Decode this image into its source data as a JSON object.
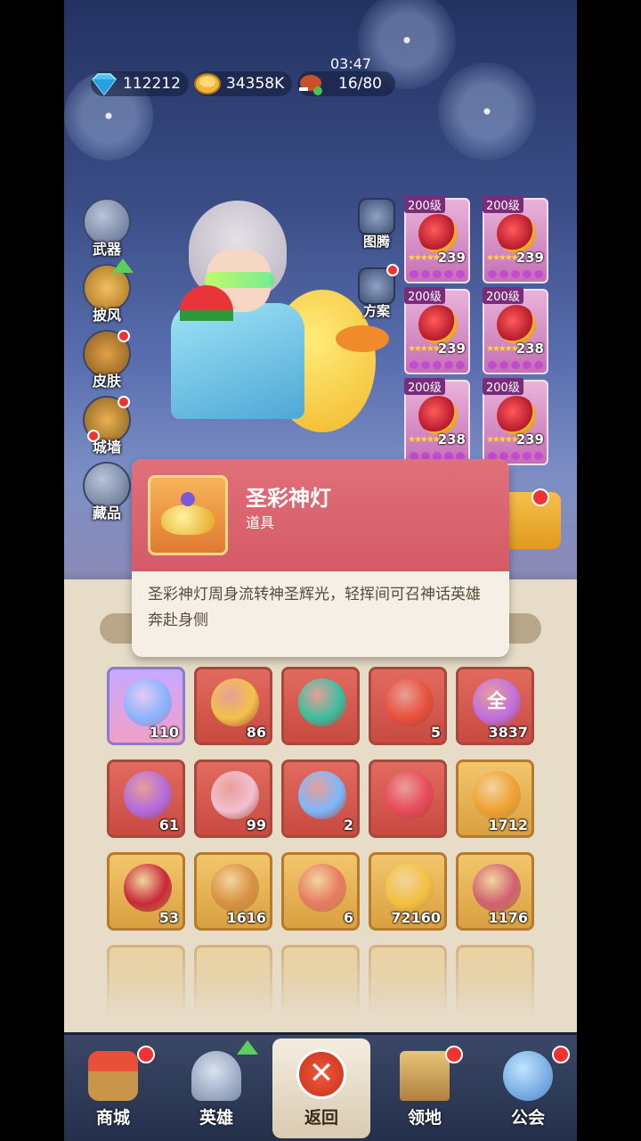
{
  "top_bar": {
    "diamonds": "112212",
    "gold": "34358K",
    "timer": "03:47",
    "stamina": "16/80"
  },
  "left_menu": [
    {
      "label": "武器",
      "icon": "weapon-icon"
    },
    {
      "label": "披风",
      "icon": "cape-icon"
    },
    {
      "label": "皮肤",
      "icon": "skin-icon"
    },
    {
      "label": "城墙",
      "icon": "wall-icon"
    },
    {
      "label": "藏品",
      "icon": "collection-icon"
    }
  ],
  "right_menu": [
    {
      "label": "图腾",
      "icon": "totem-icon"
    },
    {
      "label": "方案",
      "icon": "scheme-icon"
    }
  ],
  "equipment_slots": [
    {
      "level": "200级",
      "count": "239"
    },
    {
      "level": "200级",
      "count": "239"
    },
    {
      "level": "200级",
      "count": "239"
    },
    {
      "level": "200级",
      "count": "238"
    },
    {
      "level": "200级",
      "count": "238"
    },
    {
      "level": "200级",
      "count": "239"
    }
  ],
  "tooltip": {
    "title": "圣彩神灯",
    "type": "道具",
    "description": "圣彩神灯周身流转神圣辉光，轻挥间可召神话英雄奔赴身侧"
  },
  "inventory": [
    {
      "count": "110",
      "style": "purple"
    },
    {
      "count": "86",
      "style": "red"
    },
    {
      "count": "",
      "style": "red"
    },
    {
      "count": "5",
      "style": "red"
    },
    {
      "count": "3837",
      "style": "red",
      "glyph": "全"
    },
    {
      "count": "61",
      "style": "red"
    },
    {
      "count": "99",
      "style": "red"
    },
    {
      "count": "2",
      "style": "red"
    },
    {
      "count": "",
      "style": "red"
    },
    {
      "count": "1712",
      "style": "gold"
    },
    {
      "count": "53",
      "style": "gold"
    },
    {
      "count": "1616",
      "style": "gold"
    },
    {
      "count": "6",
      "style": "gold"
    },
    {
      "count": "72160",
      "style": "gold"
    },
    {
      "count": "1176",
      "style": "gold"
    }
  ],
  "bottom_nav": [
    {
      "label": "商城",
      "icon": "shop-icon"
    },
    {
      "label": "英雄",
      "icon": "hero-helmet-icon"
    },
    {
      "label": "返回",
      "icon": "close-icon"
    },
    {
      "label": "领地",
      "icon": "castle-icon"
    },
    {
      "label": "公会",
      "icon": "guild-planet-icon"
    }
  ],
  "colors": {
    "tooltip_header": "#d45a66",
    "red_cell": "#c84a40",
    "gold_cell": "#d9a040",
    "nav_bg": "#2f3b58"
  }
}
